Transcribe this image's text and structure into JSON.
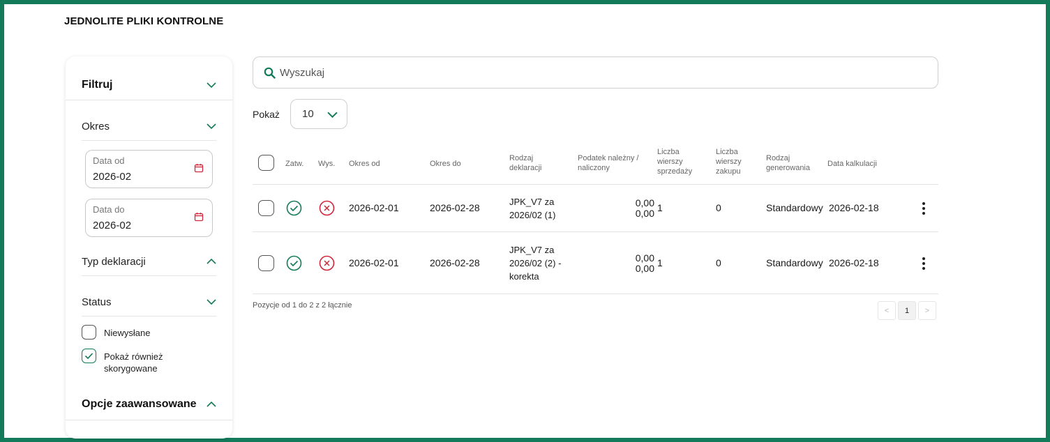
{
  "page_title": "JEDNOLITE PLIKI KONTROLNE",
  "sidebar": {
    "filter_title": "Filtruj",
    "period_title": "Okres",
    "date_from": {
      "label": "Data od",
      "value": "2026-02"
    },
    "date_to": {
      "label": "Data do",
      "value": "2026-02"
    },
    "declaration_type_title": "Typ deklaracji",
    "status_title": "Status",
    "checkboxes": [
      {
        "label": "Niewysłane",
        "checked": false
      },
      {
        "label_line1": "Pokaż również",
        "label_line2": "skorygowane",
        "checked": true
      }
    ],
    "advanced_title": "Opcje zaawansowane"
  },
  "search": {
    "placeholder": "Wyszukaj"
  },
  "page_size": {
    "label": "Pokaż",
    "value": "10"
  },
  "table": {
    "headers": {
      "approved": "Zatw.",
      "sent": "Wys.",
      "period_from": "Okres od",
      "period_to": "Okres do",
      "decl_type_1": "Rodzaj",
      "decl_type_2": "deklaracji",
      "tax_1": "Podatek należny /",
      "tax_2": "naliczony",
      "sales_1": "Liczba",
      "sales_2": "wierszy",
      "sales_3": "sprzedaży",
      "purch_1": "Liczba",
      "purch_2": "wierszy",
      "purch_3": "zakupu",
      "gen_1": "Rodzaj",
      "gen_2": "generowania",
      "calc_date": "Data kalkulacji"
    },
    "rows": [
      {
        "period_from": "2026-02-01",
        "period_to": "2026-02-28",
        "decl_1": "JPK_V7 za",
        "decl_2": "2026/02 (1)",
        "tax_due": "0,00",
        "tax_input": "0,00",
        "sales_rows": "1",
        "purchase_rows": "0",
        "generation": "Standardowy",
        "calc_date": "2026-02-18"
      },
      {
        "period_from": "2026-02-01",
        "period_to": "2026-02-28",
        "decl_1": "JPK_V7 za",
        "decl_2": "2026/02 (2) -",
        "decl_3": "korekta",
        "tax_due": "0,00",
        "tax_input": "0,00",
        "sales_rows": "1",
        "purchase_rows": "0",
        "generation": "Standardowy",
        "calc_date": "2026-02-18"
      }
    ]
  },
  "footer": {
    "summary": "Pozycje od 1 do 2 z 2 łącznie",
    "prev": "<",
    "page": "1",
    "next": ">"
  },
  "colors": {
    "accent": "#137a5a",
    "error": "#d0263a",
    "frame": "#137a5a"
  }
}
